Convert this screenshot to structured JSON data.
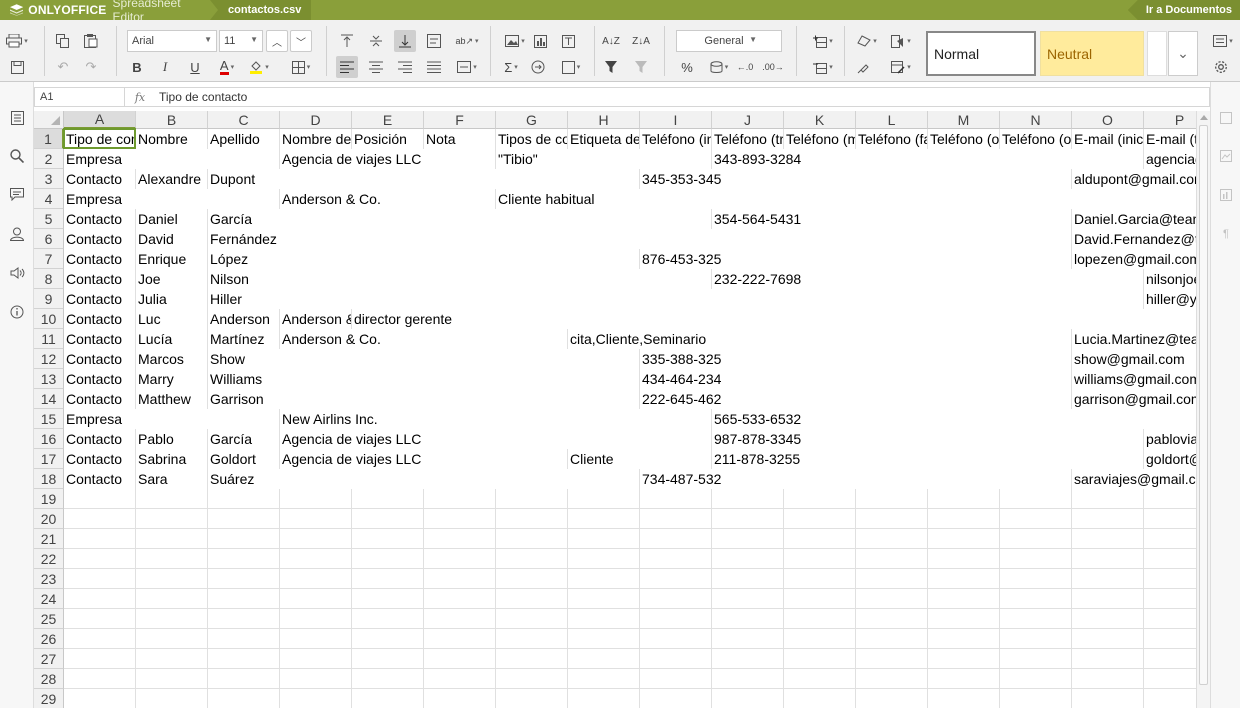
{
  "app": {
    "brand": "ONLYOFFICE",
    "editor": "Spreadsheet Editor",
    "filename": "contactos.csv",
    "goto_docs": "Ir a Documentos"
  },
  "toolbar": {
    "font_name": "Arial",
    "font_size": "11",
    "number_format": "General",
    "styles": [
      "Normal",
      "Neutral"
    ],
    "style_colors": {
      "neutral_bg": "#ffeb9c",
      "neutral_text": "#9c6500"
    },
    "buttons": {
      "bold": "B",
      "italic": "I",
      "underline": "U",
      "font_color": "A",
      "percent": "%",
      "sum": "Σ"
    }
  },
  "formula_bar": {
    "cell_ref": "A1",
    "fx": "fx",
    "value": "Tipo de contacto"
  },
  "sheet": {
    "columns": [
      "A",
      "B",
      "C",
      "D",
      "E",
      "F",
      "G",
      "H",
      "I",
      "J",
      "K",
      "L",
      "M",
      "N",
      "O",
      "P"
    ],
    "rows": [
      "1",
      "2",
      "3",
      "4",
      "5",
      "6",
      "7",
      "8",
      "9",
      "10",
      "11",
      "12",
      "13",
      "14",
      "15",
      "16",
      "17",
      "18",
      "19",
      "20",
      "21",
      "22",
      "23",
      "24",
      "25",
      "26",
      "27",
      "28",
      "29"
    ],
    "data": [
      [
        "Tipo de contacto",
        "Nombre",
        "Apellido",
        "Nombre de la empresa",
        "Posición",
        "Nota",
        "Tipos de contacto",
        "Etiqueta de contacto",
        "Teléfono (inicio)",
        "Teléfono (trabajo)",
        "Teléfono (móvil)",
        "Teléfono (fax)",
        "Teléfono (otro)",
        "Teléfono (otro)",
        "E-mail (inicio)",
        "E-mail (trabajo)"
      ],
      [
        "Empresa",
        "",
        "",
        "Agencia de viajes LLC",
        "",
        "",
        "\"Tibio\"",
        "",
        "",
        "343-893-3284",
        "",
        "",
        "",
        "",
        "",
        "agenciadeviajes@gmail.com"
      ],
      [
        "Contacto",
        "Alexandre",
        "Dupont",
        "",
        "",
        "",
        "",
        "",
        "345-353-345",
        "",
        "",
        "",
        "",
        "",
        "aldupont@gmail.com",
        ""
      ],
      [
        "Empresa",
        "",
        "",
        "Anderson & Co.",
        "",
        "",
        "Cliente habitual",
        "",
        "",
        "",
        "",
        "",
        "",
        "",
        "",
        ""
      ],
      [
        "Contacto",
        "Daniel",
        "García",
        "",
        "",
        "",
        "",
        "",
        "",
        "354-564-5431",
        "",
        "",
        "",
        "",
        "Daniel.Garcia@teamlab.com",
        ""
      ],
      [
        "Contacto",
        "David",
        "Fernández",
        "",
        "",
        "",
        "",
        "",
        "",
        "",
        "",
        "",
        "",
        "",
        "David.Fernandez@teamlab.com",
        ""
      ],
      [
        "Contacto",
        "Enrique",
        "López",
        "",
        "",
        "",
        "",
        "",
        "876-453-325",
        "",
        "",
        "",
        "",
        "",
        "lopezen@gmail.com",
        ""
      ],
      [
        "Contacto",
        "Joe",
        "Nilson",
        "",
        "",
        "",
        "",
        "",
        "",
        "232-222-7698",
        "",
        "",
        "",
        "",
        "",
        "nilsonjoe@gmail.com"
      ],
      [
        "Contacto",
        "Julia",
        "Hiller",
        "",
        "",
        "",
        "",
        "",
        "",
        "",
        "",
        "",
        "",
        "",
        "",
        "hiller@yahoo.com"
      ],
      [
        "Contacto",
        "Luc",
        "Anderson",
        "Anderson & Co.",
        "director gerente",
        "",
        "",
        "",
        "",
        "",
        "",
        "",
        "",
        "",
        "",
        ""
      ],
      [
        "Contacto",
        "Lucía",
        "Martínez",
        "Anderson & Co.",
        "",
        "",
        "",
        "cita,Cliente,Seminario",
        "",
        "",
        "",
        "",
        "",
        "",
        "Lucia.Martinez@teamlab.com",
        ""
      ],
      [
        "Contacto",
        "Marcos",
        "Show",
        "",
        "",
        "",
        "",
        "",
        "335-388-325",
        "",
        "",
        "",
        "",
        "",
        "show@gmail.com",
        ""
      ],
      [
        "Contacto",
        "Marry",
        "Williams",
        "",
        "",
        "",
        "",
        "",
        "434-464-234",
        "",
        "",
        "",
        "",
        "",
        "williams@gmail.com",
        ""
      ],
      [
        "Contacto",
        "Matthew",
        "Garrison",
        "",
        "",
        "",
        "",
        "",
        "222-645-462",
        "",
        "",
        "",
        "",
        "",
        "garrison@gmail.com",
        ""
      ],
      [
        "Empresa",
        "",
        "",
        "New Airlins Inc.",
        "",
        "",
        "",
        "",
        "",
        "565-533-6532",
        "",
        "",
        "",
        "",
        "",
        ""
      ],
      [
        "Contacto",
        "Pablo",
        "García",
        "Agencia de viajes LLC",
        "",
        "",
        "",
        "",
        "",
        "987-878-3345",
        "",
        "",
        "",
        "",
        "",
        "pabloviajes@gmail.com"
      ],
      [
        "Contacto",
        "Sabrina",
        "Goldort",
        "Agencia de viajes LLC",
        "",
        "",
        "",
        "Cliente",
        "",
        "211-878-3255",
        "",
        "",
        "",
        "",
        "",
        "goldort@gmail.com"
      ],
      [
        "Contacto",
        "Sara",
        "Suárez",
        "",
        "",
        "",
        "",
        "",
        "734-487-532",
        "",
        "",
        "",
        "",
        "",
        "saraviajes@gmail.com",
        ""
      ]
    ]
  },
  "icons": {
    "left_sidebar": [
      "file-icon",
      "search-icon",
      "comments-icon",
      "user-icon",
      "feedback-icon",
      "info-icon"
    ],
    "right_sidebar": [
      "cell-settings-icon",
      "image-settings-icon",
      "chart-settings-icon",
      "paragraph-icon"
    ]
  }
}
